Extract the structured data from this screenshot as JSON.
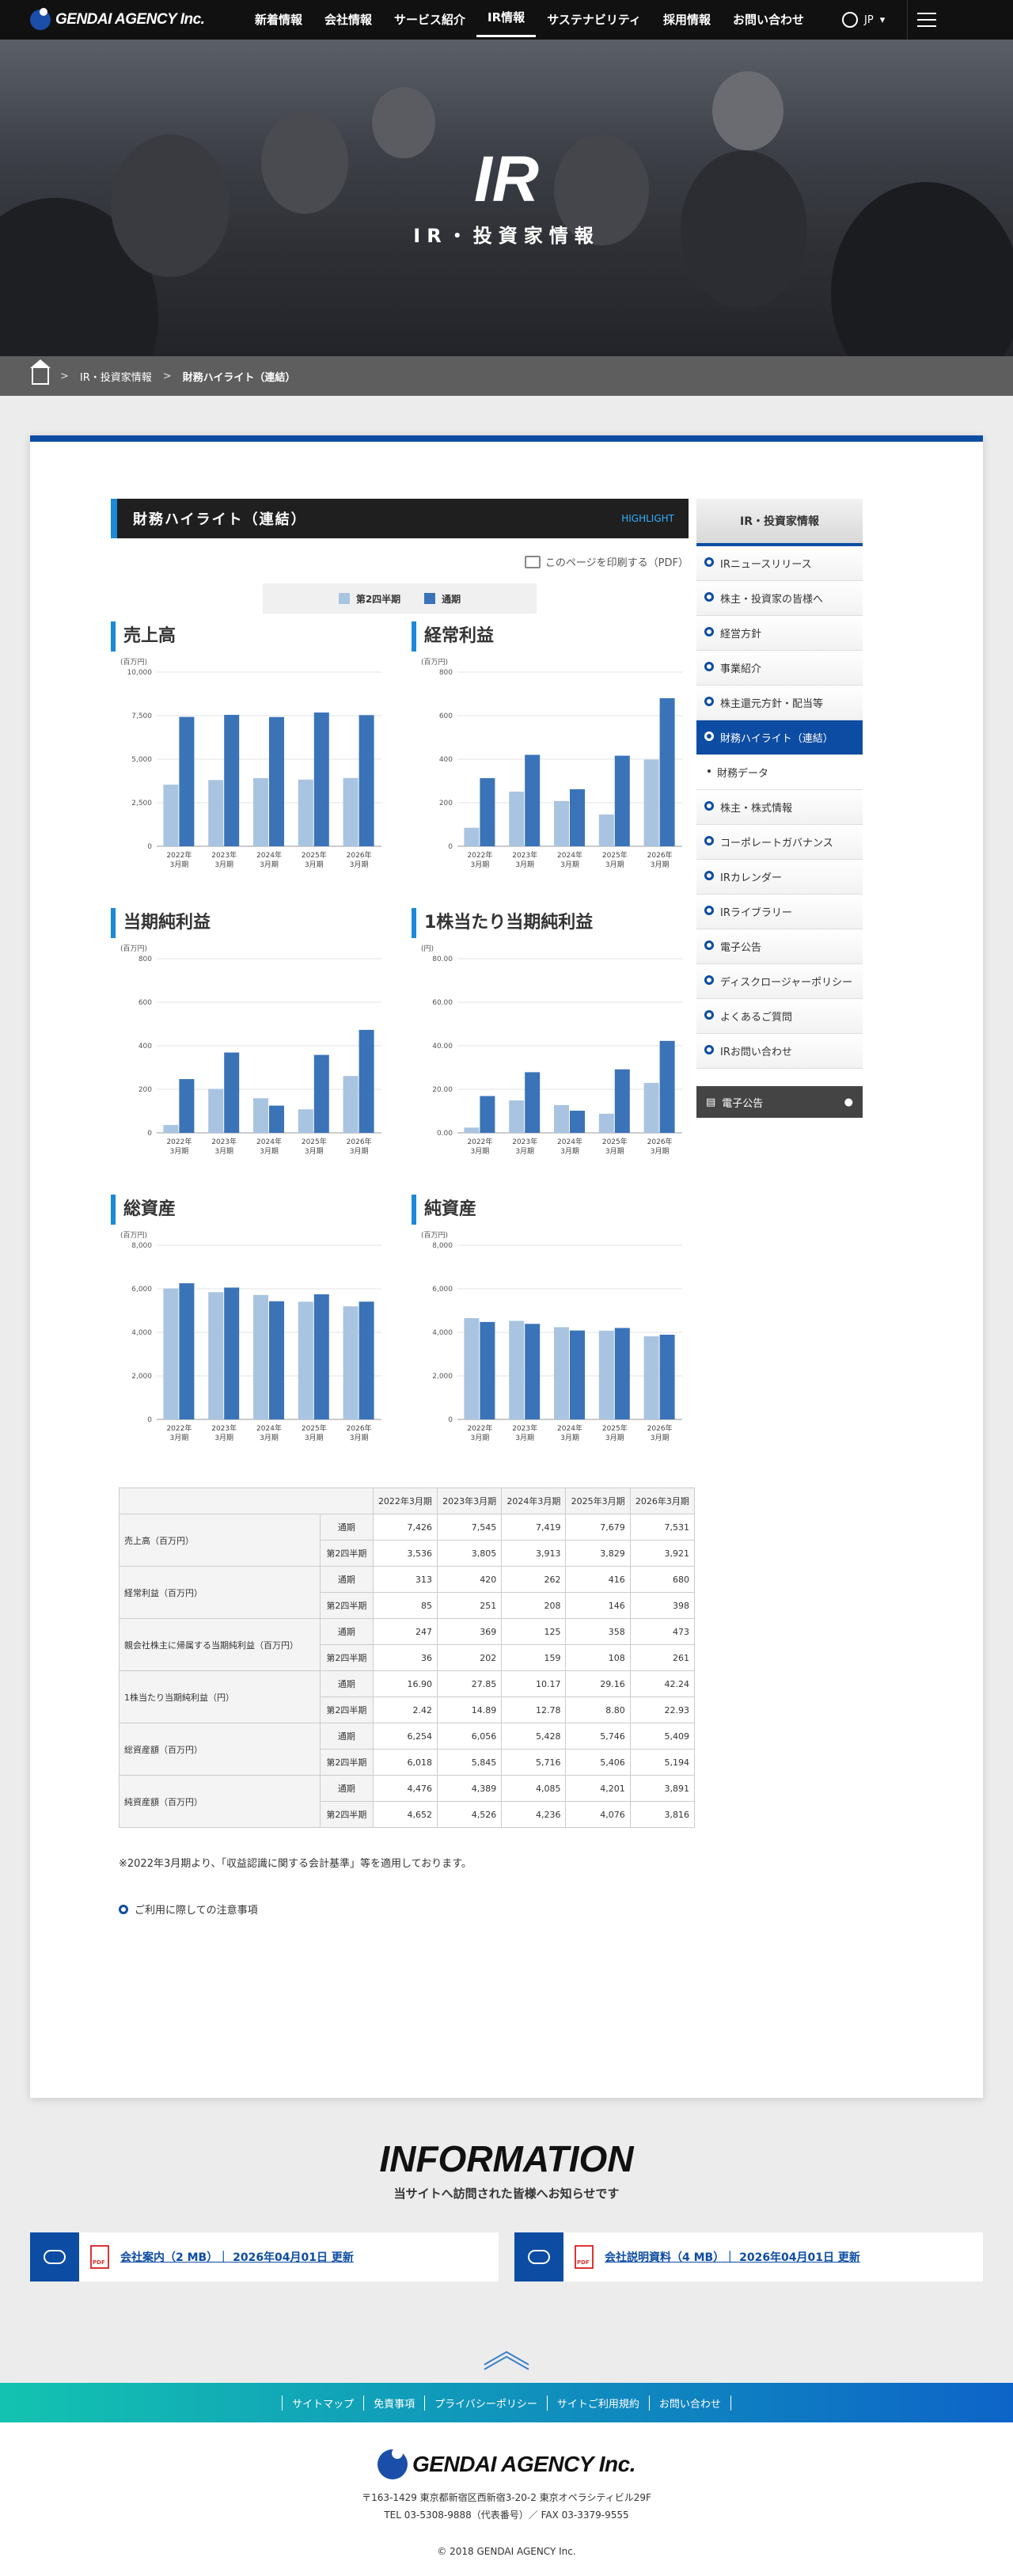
{
  "header": {
    "logo": "GENDAI AGENCY Inc.",
    "nav": [
      "新着情報",
      "会社情報",
      "サービス紹介",
      "IR情報",
      "サステナビリティ",
      "採用情報",
      "お問い合わせ"
    ],
    "active_nav": "IR情報",
    "lang": "JP"
  },
  "hero": {
    "title": "IR",
    "subtitle": "IR・投資家情報"
  },
  "breadcrumb": {
    "parent": "IR・投資家情報",
    "current": "財務ハイライト（連結）"
  },
  "section": {
    "title": "財務ハイライト（連結）",
    "tag": "HIGHLIGHT",
    "print": "このページを印刷する（PDF）"
  },
  "legend": {
    "half": "第2四半期",
    "full": "通期",
    "half_color": "#a9c4e0",
    "full_color": "#3a73b8"
  },
  "categories": [
    "2022年\n3月期",
    "2023年\n3月期",
    "2024年\n3月期",
    "2025年\n3月期",
    "2026年\n3月期"
  ],
  "chart_data": [
    {
      "type": "bar",
      "title": "売上高",
      "unit": "(百万円)",
      "ylim": [
        0,
        10000
      ],
      "ticks": [
        "0",
        "2,500",
        "5,000",
        "7,500",
        "10,000"
      ],
      "tickvals": [
        0,
        2500,
        5000,
        7500,
        10000
      ],
      "series": [
        {
          "name": "第2四半期",
          "values": [
            3536,
            3805,
            3913,
            3829,
            3921
          ]
        },
        {
          "name": "通期",
          "values": [
            7426,
            7545,
            7419,
            7679,
            7531
          ]
        }
      ]
    },
    {
      "type": "bar",
      "title": "経常利益",
      "unit": "(百万円)",
      "ylim": [
        0,
        800
      ],
      "ticks": [
        "0",
        "200",
        "400",
        "600",
        "800"
      ],
      "tickvals": [
        0,
        200,
        400,
        600,
        800
      ],
      "series": [
        {
          "name": "第2四半期",
          "values": [
            85,
            251,
            208,
            146,
            398
          ]
        },
        {
          "name": "通期",
          "values": [
            313,
            420,
            262,
            416,
            680
          ]
        }
      ]
    },
    {
      "type": "bar",
      "title": "当期純利益",
      "unit": "(百万円)",
      "ylim": [
        0,
        800
      ],
      "ticks": [
        "0",
        "200",
        "400",
        "600",
        "800"
      ],
      "tickvals": [
        0,
        200,
        400,
        600,
        800
      ],
      "series": [
        {
          "name": "第2四半期",
          "values": [
            36,
            202,
            159,
            108,
            261
          ]
        },
        {
          "name": "通期",
          "values": [
            247,
            369,
            125,
            358,
            473
          ]
        }
      ]
    },
    {
      "type": "bar",
      "title": "1株当たり当期純利益",
      "unit": "(円)",
      "ylim": [
        0,
        80
      ],
      "ticks": [
        "0.00",
        "20.00",
        "40.00",
        "60.00",
        "80.00"
      ],
      "tickvals": [
        0,
        20,
        40,
        60,
        80
      ],
      "series": [
        {
          "name": "第2四半期",
          "values": [
            2.42,
            14.89,
            12.78,
            8.8,
            22.93
          ]
        },
        {
          "name": "通期",
          "values": [
            16.9,
            27.85,
            10.17,
            29.16,
            42.24
          ]
        }
      ]
    },
    {
      "type": "bar",
      "title": "総資産",
      "unit": "(百万円)",
      "ylim": [
        0,
        8000
      ],
      "ticks": [
        "0",
        "2,000",
        "4,000",
        "6,000",
        "8,000"
      ],
      "tickvals": [
        0,
        2000,
        4000,
        6000,
        8000
      ],
      "series": [
        {
          "name": "第2四半期",
          "values": [
            6018,
            5845,
            5716,
            5406,
            5194
          ]
        },
        {
          "name": "通期",
          "values": [
            6254,
            6056,
            5428,
            5746,
            5409
          ]
        }
      ]
    },
    {
      "type": "bar",
      "title": "純資産",
      "unit": "(百万円)",
      "ylim": [
        0,
        8000
      ],
      "ticks": [
        "0",
        "2,000",
        "4,000",
        "6,000",
        "8,000"
      ],
      "tickvals": [
        0,
        2000,
        4000,
        6000,
        8000
      ],
      "series": [
        {
          "name": "第2四半期",
          "values": [
            4652,
            4526,
            4236,
            4076,
            3816
          ]
        },
        {
          "name": "通期",
          "values": [
            4476,
            4389,
            4085,
            4201,
            3891
          ]
        }
      ]
    }
  ],
  "table": {
    "headers": [
      "2022年3月期",
      "2023年3月期",
      "2024年3月期",
      "2025年3月期",
      "2026年3月期"
    ],
    "period_full": "通期",
    "period_half": "第2四半期",
    "rows": [
      {
        "label": "売上高（百万円）",
        "full": [
          "7,426",
          "7,545",
          "7,419",
          "7,679",
          "7,531"
        ],
        "half": [
          "3,536",
          "3,805",
          "3,913",
          "3,829",
          "3,921"
        ]
      },
      {
        "label": "経常利益（百万円）",
        "full": [
          "313",
          "420",
          "262",
          "416",
          "680"
        ],
        "half": [
          "85",
          "251",
          "208",
          "146",
          "398"
        ]
      },
      {
        "label": "親会社株主に帰属する当期純利益（百万円）",
        "full": [
          "247",
          "369",
          "125",
          "358",
          "473"
        ],
        "half": [
          "36",
          "202",
          "159",
          "108",
          "261"
        ]
      },
      {
        "label": "1株当たり当期純利益（円）",
        "full": [
          "16.90",
          "27.85",
          "10.17",
          "29.16",
          "42.24"
        ],
        "half": [
          "2.42",
          "14.89",
          "12.78",
          "8.80",
          "22.93"
        ]
      },
      {
        "label": "総資産額（百万円）",
        "full": [
          "6,254",
          "6,056",
          "5,428",
          "5,746",
          "5,409"
        ],
        "half": [
          "6,018",
          "5,845",
          "5,716",
          "5,406",
          "5,194"
        ]
      },
      {
        "label": "純資産額（百万円）",
        "full": [
          "4,476",
          "4,389",
          "4,085",
          "4,201",
          "3,891"
        ],
        "half": [
          "4,652",
          "4,526",
          "4,236",
          "4,076",
          "3,816"
        ]
      }
    ]
  },
  "note": "※2022年3月期より、「収益認識に関する会計基準」等を適用しております。",
  "notice_link": "ご利用に際しての注意事項",
  "sidebar": {
    "title": "IR・投資家情報",
    "items": [
      "IRニュースリリース",
      "株主・投資家の皆様へ",
      "経営方針",
      "事業紹介",
      "株主還元方針・配当等",
      "財務ハイライト（連結）",
      "財務データ",
      "株主・株式情報",
      "コーポレートガバナンス",
      "IRカレンダー",
      "IRライブラリー",
      "電子公告",
      "ディスクロージャーポリシー",
      "よくあるご質問",
      "IRお問い合わせ"
    ],
    "box": "電子公告"
  },
  "info": {
    "title": "INFORMATION",
    "subtitle": "当サイトへ訪問された皆様へお知らせです",
    "downloads": [
      "会社案内（2 MB）｜ 2026年04月01日 更新",
      "会社説明資料（4 MB）｜ 2026年04月01日 更新"
    ]
  },
  "footnav": [
    "サイトマップ",
    "免責事項",
    "プライバシーポリシー",
    "サイトご利用規約",
    "お問い合わせ"
  ],
  "footer": {
    "logo": "GENDAI AGENCY Inc.",
    "address": "〒163-1429 東京都新宿区西新宿3-20-2 東京オペラシティビル29F",
    "tel": "TEL 03-5308-9888（代表番号）／ FAX 03-3379-9555",
    "copyright": "© 2018 GENDAI AGENCY Inc."
  }
}
